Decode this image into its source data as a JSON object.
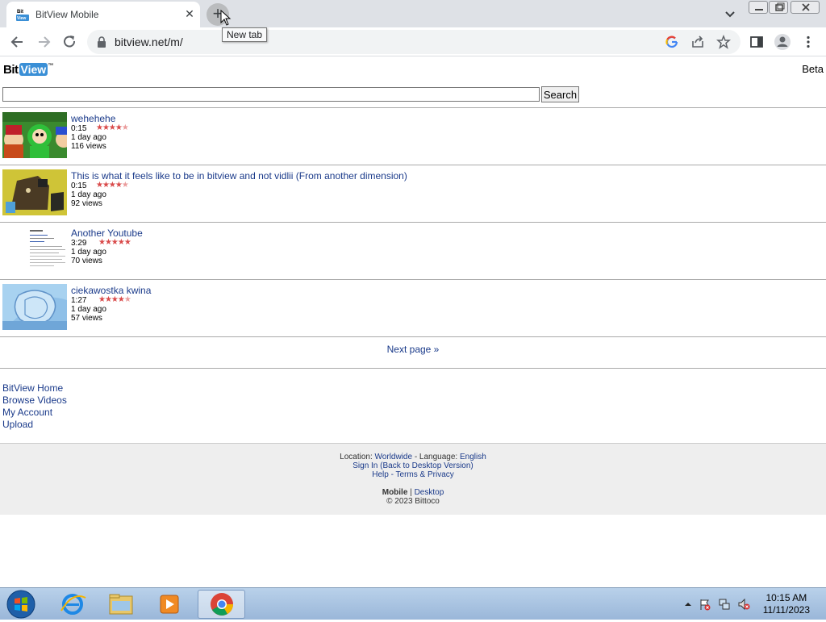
{
  "browser": {
    "tab_title": "BitView Mobile",
    "tab_favicon_text": "Bit View",
    "tooltip": "New tab",
    "url": "bitview.net/m/"
  },
  "page": {
    "logo": {
      "bit": "Bit",
      "view": "View",
      "tm": "™"
    },
    "beta": "Beta",
    "search": {
      "value": "",
      "button": "Search"
    },
    "videos": [
      {
        "title": "wehehehe",
        "duration": "0:15",
        "rating": 4.5,
        "ago": "1 day ago",
        "views": "116 views",
        "thumb": "cartoon"
      },
      {
        "title": "This is what it feels like to be in bitview and not vidlii (From another dimension)",
        "duration": "0:15",
        "rating": 4.5,
        "ago": "1 day ago",
        "views": "92 views",
        "thumb": "scene3d"
      },
      {
        "title": "Another Youtube",
        "duration": "3:29",
        "rating": 5,
        "ago": "1 day ago",
        "views": "70 views",
        "thumb": "webpage"
      },
      {
        "title": "ciekawostka kwina",
        "duration": "1:27",
        "rating": 4.5,
        "ago": "1 day ago",
        "views": "57 views",
        "thumb": "blue"
      }
    ],
    "next_page": "Next page »",
    "links": [
      "BitView Home",
      "Browse Videos",
      "My Account",
      "Upload"
    ],
    "footer": {
      "location_label": "Location:",
      "location_value": "Worldwide",
      "language_label": "- Language:",
      "language_value": "English",
      "sign_in": "Sign In",
      "desktop_version": "(Back to Desktop Version)",
      "help": "Help",
      "terms": "Terms & Privacy",
      "mobile": "Mobile",
      "desktop": "Desktop",
      "copyright": "© 2023 Bittoco"
    }
  },
  "taskbar": {
    "time": "10:15 AM",
    "date": "11/11/2023"
  }
}
